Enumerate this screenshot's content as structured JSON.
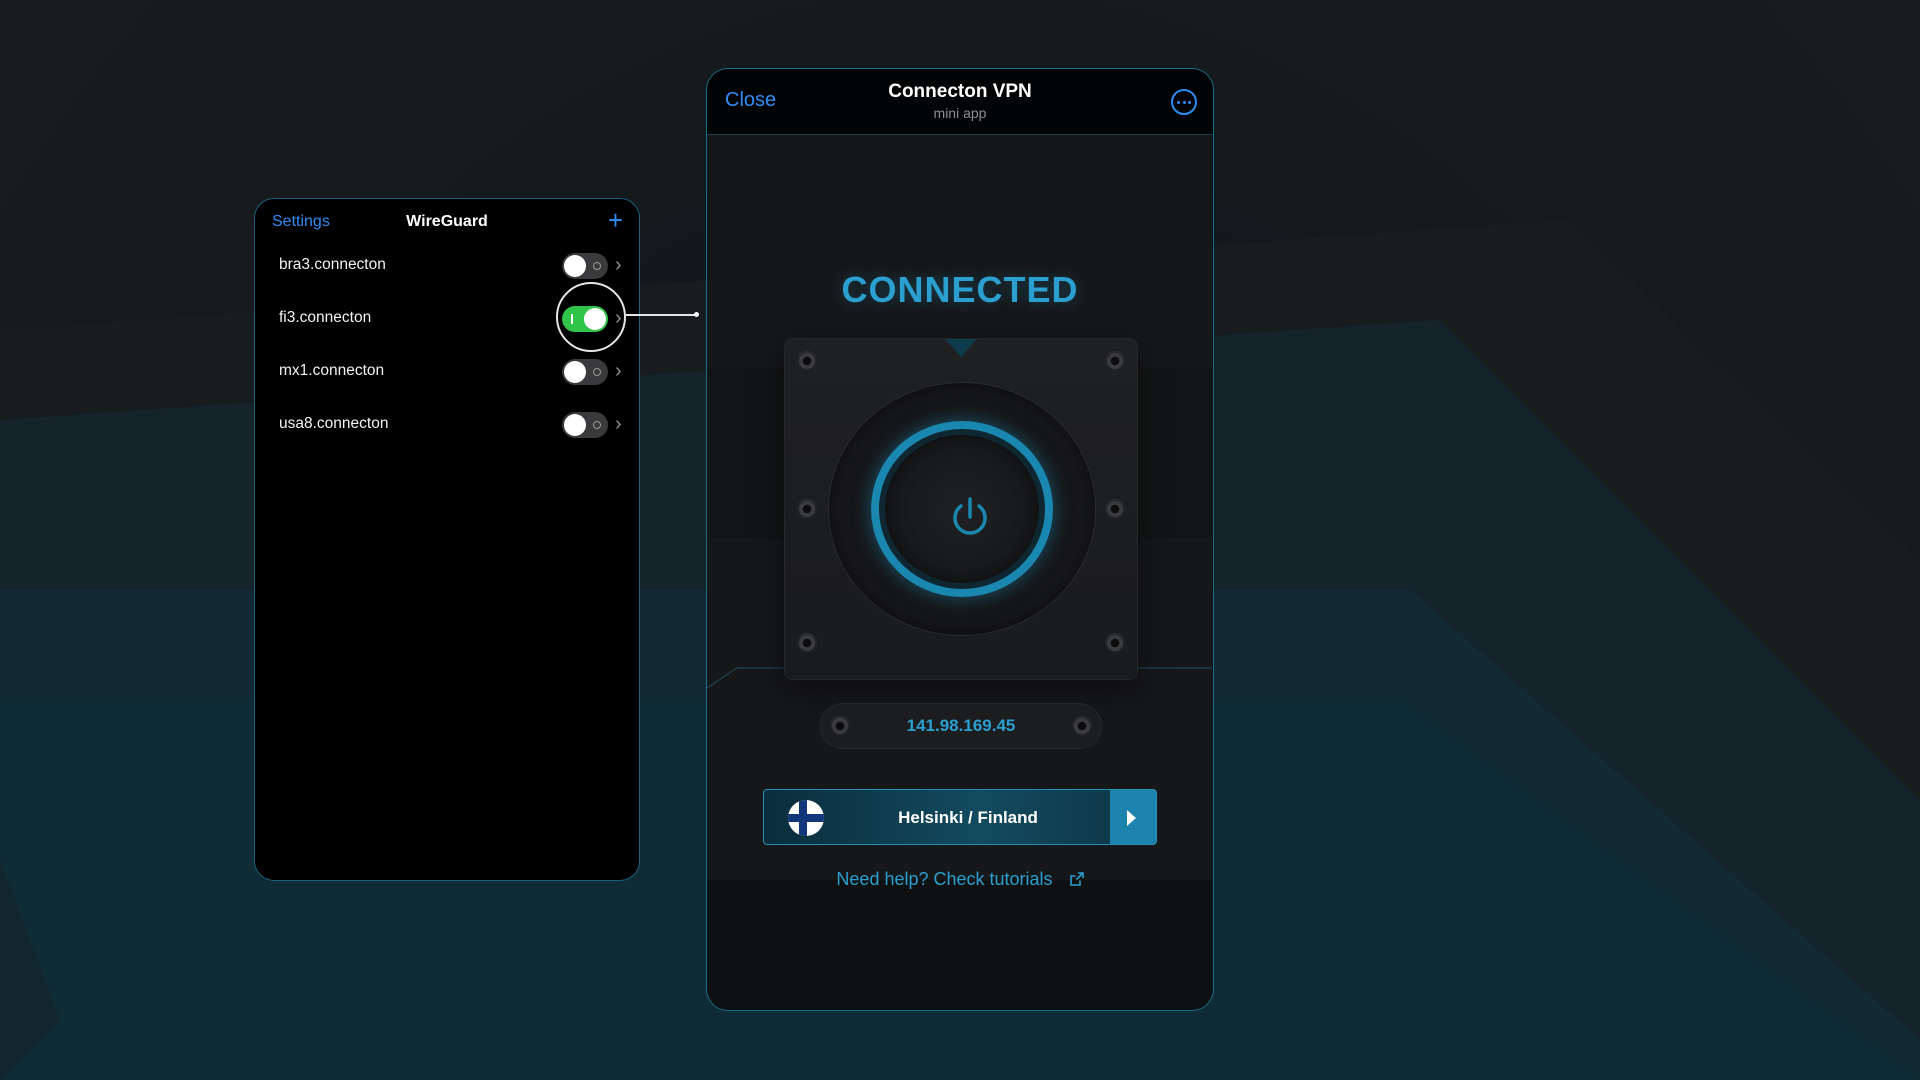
{
  "wireguard": {
    "back_label": "Settings",
    "title": "WireGuard",
    "add_icon": "plus-icon",
    "tunnels": [
      {
        "name": "bra3.connecton",
        "enabled": false
      },
      {
        "name": "fi3.connecton",
        "enabled": true
      },
      {
        "name": "mx1.connecton",
        "enabled": false
      },
      {
        "name": "usa8.connecton",
        "enabled": false
      }
    ]
  },
  "vpn": {
    "close_label": "Close",
    "title": "Connecton VPN",
    "subtitle": "mini app",
    "more_icon": "ellipsis-circle-icon",
    "status": "CONNECTED",
    "ip": "141.98.169.45",
    "location": "Helsinki / Finland",
    "flag_icon": "finland-flag-icon",
    "help_text": "Need help? Check tutorials",
    "help_icon": "external-link-icon"
  },
  "colors": {
    "accent": "#2b9fcf",
    "ios_blue": "#2f8bf5",
    "toggle_on": "#30c448",
    "background": "#161719"
  }
}
